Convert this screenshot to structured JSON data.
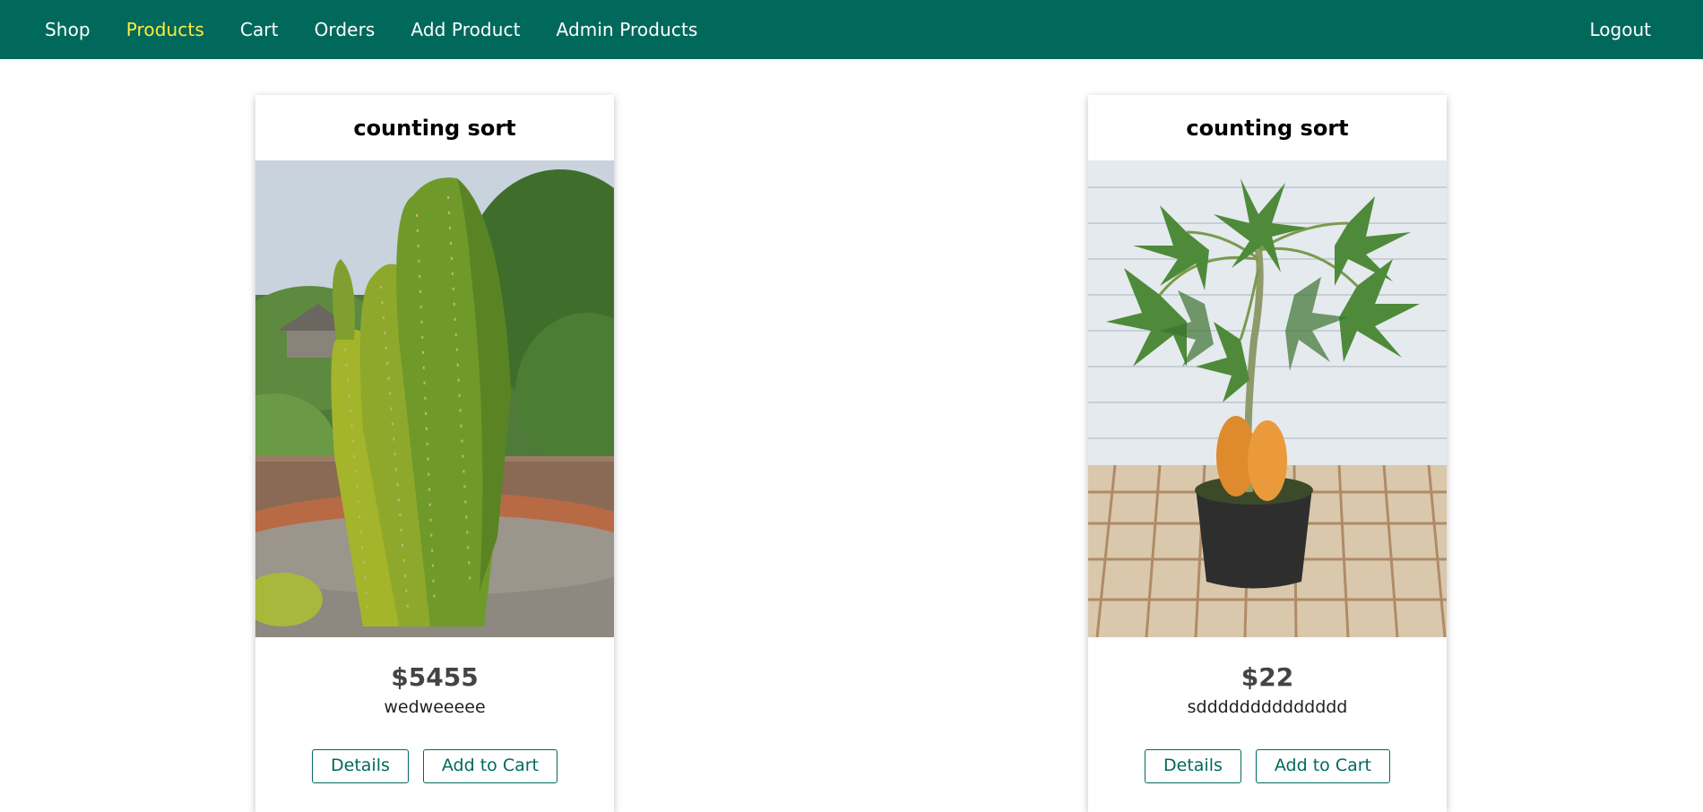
{
  "nav": {
    "links": [
      {
        "label": "Shop",
        "active": false
      },
      {
        "label": "Products",
        "active": true
      },
      {
        "label": "Cart",
        "active": false
      },
      {
        "label": "Orders",
        "active": false
      },
      {
        "label": "Add Product",
        "active": false
      },
      {
        "label": "Admin Products",
        "active": false
      }
    ],
    "logout_label": "Logout"
  },
  "products": [
    {
      "title": "counting sort",
      "image_icon": "cactus-image",
      "price": "$5455",
      "description": "wedweeeee",
      "details_label": "Details",
      "add_to_cart_label": "Add to Cart"
    },
    {
      "title": "counting sort",
      "image_icon": "papaya-plant-image",
      "price": "$22",
      "description": "sdddddddddddddd",
      "details_label": "Details",
      "add_to_cart_label": "Add to Cart"
    }
  ],
  "colors": {
    "header_bg": "#00695c",
    "active_link": "#ffeb3b",
    "button_accent": "#00695c"
  }
}
